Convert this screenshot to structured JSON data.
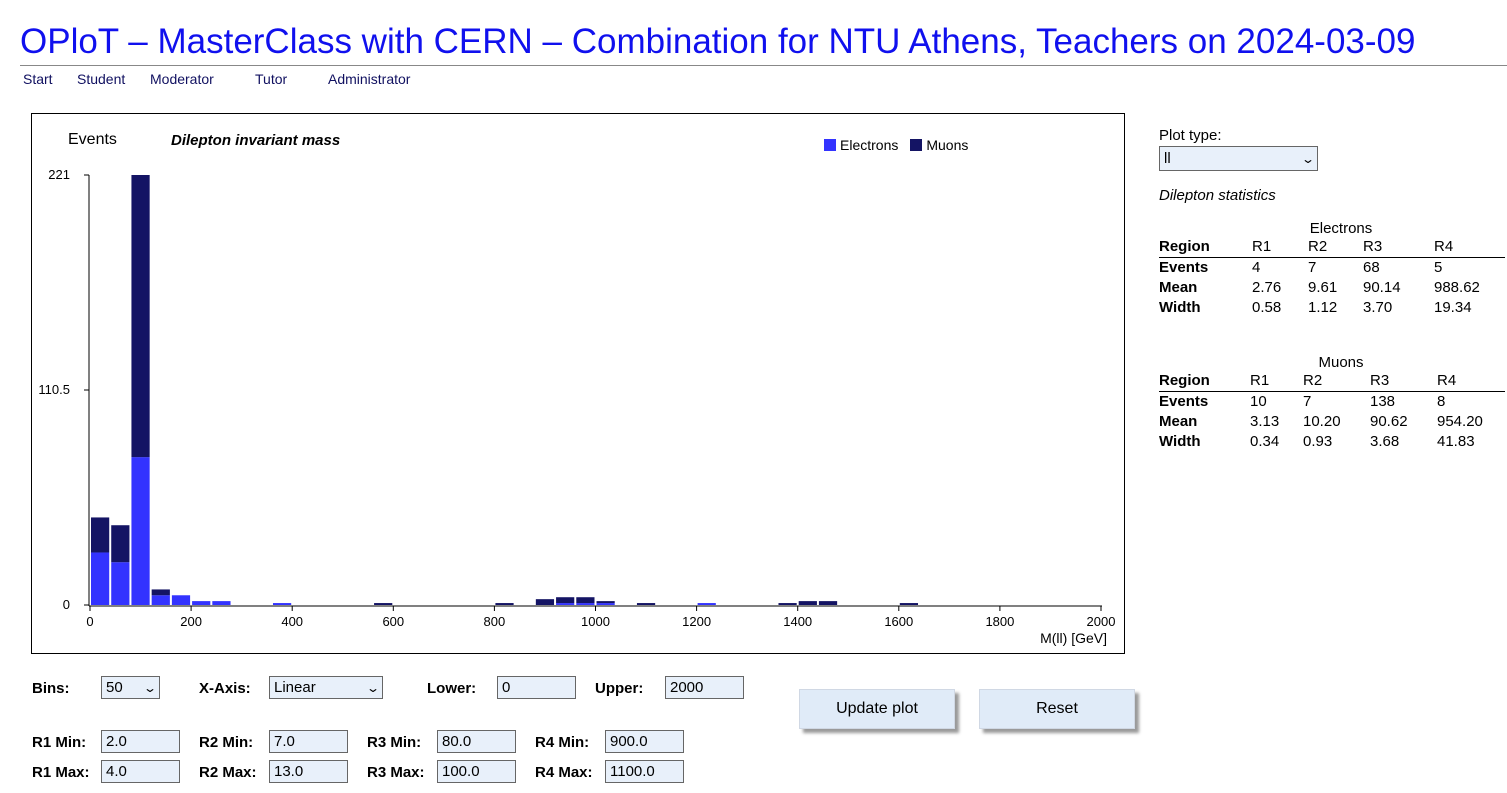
{
  "page": {
    "title": "OPloT – MasterClass with CERN – Combination for NTU Athens, Teachers on 2024-03-09"
  },
  "nav": [
    "Start",
    "Student",
    "Moderator",
    "Tutor",
    "Administrator"
  ],
  "chart_data": {
    "type": "bar",
    "stacked": true,
    "title": "Dilepton invariant mass",
    "ylabel": "Events",
    "xlabel": "M(ll) [GeV]",
    "xlim": [
      0,
      2000
    ],
    "ylim": [
      0,
      221
    ],
    "yticks": [
      "221",
      "110.5",
      "0"
    ],
    "xticks": [
      "0",
      "200",
      "400",
      "600",
      "800",
      "1000",
      "1200",
      "1400",
      "1600",
      "1800",
      "2000"
    ],
    "legend_position": "top-right",
    "bin_width": 40,
    "bin_starts": [
      0,
      40,
      80,
      120,
      160,
      200,
      240,
      360,
      560,
      800,
      880,
      920,
      960,
      1000,
      1080,
      1200,
      1360,
      1400,
      1440,
      1600
    ],
    "series": [
      {
        "name": "Electrons",
        "color": "#3333ff",
        "values": [
          27,
          22,
          76,
          5,
          5,
          2,
          2,
          1,
          0,
          0,
          0,
          1,
          1,
          1,
          0,
          1,
          0,
          0,
          0,
          0
        ]
      },
      {
        "name": "Muons",
        "color": "#141464",
        "values": [
          18,
          19,
          145,
          3,
          0,
          0,
          0,
          0,
          1,
          1,
          3,
          3,
          3,
          1,
          1,
          0,
          1,
          2,
          2,
          1
        ]
      }
    ]
  },
  "controls": {
    "bins_label": "Bins:",
    "bins_value": "50",
    "xaxis_label": "X-Axis:",
    "xaxis_value": "Linear",
    "lower_label": "Lower:",
    "lower_value": "0",
    "upper_label": "Upper:",
    "upper_value": "2000",
    "update_button": "Update plot",
    "reset_button": "Reset",
    "regions": [
      {
        "min_label": "R1 Min:",
        "min_value": "2.0",
        "max_label": "R1 Max:",
        "max_value": "4.0"
      },
      {
        "min_label": "R2 Min:",
        "min_value": "7.0",
        "max_label": "R2 Max:",
        "max_value": "13.0"
      },
      {
        "min_label": "R3 Min:",
        "min_value": "80.0",
        "max_label": "R3 Max:",
        "max_value": "100.0"
      },
      {
        "min_label": "R4 Min:",
        "min_value": "900.0",
        "max_label": "R4 Max:",
        "max_value": "1100.0"
      }
    ]
  },
  "sidebar": {
    "plot_type_label": "Plot type:",
    "plot_type_value": "ll",
    "stats_caption": "Dilepton statistics",
    "tables": [
      {
        "caption": "Electrons",
        "header": [
          "Region",
          "R1",
          "R2",
          "R3",
          "R4"
        ],
        "rows": [
          [
            "Events",
            "4",
            "7",
            "68",
            "5"
          ],
          [
            "Mean",
            "2.76",
            "9.61",
            "90.14",
            "988.62"
          ],
          [
            "Width",
            "0.58",
            "1.12",
            "3.70",
            "19.34"
          ]
        ]
      },
      {
        "caption": "Muons",
        "header": [
          "Region",
          "R1",
          "R2",
          "R3",
          "R4"
        ],
        "rows": [
          [
            "Events",
            "10",
            "7",
            "138",
            "8"
          ],
          [
            "Mean",
            "3.13",
            "10.20",
            "90.62",
            "954.20"
          ],
          [
            "Width",
            "0.34",
            "0.93",
            "3.68",
            "41.83"
          ]
        ]
      }
    ]
  }
}
